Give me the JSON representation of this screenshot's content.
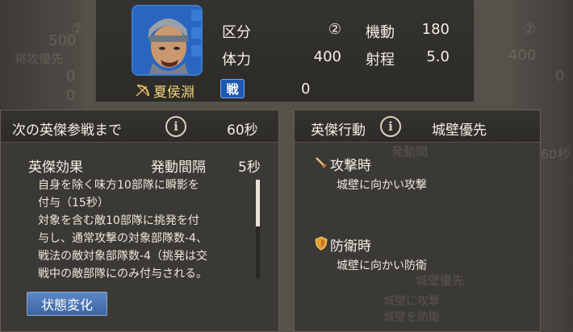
{
  "hero": {
    "name": "夏侯淵",
    "troop_type_badge": "戦",
    "war_value": "0"
  },
  "stats": {
    "category_label": "区分",
    "category_value": "②",
    "mobility_label": "機動",
    "mobility_value": "180",
    "hp_label": "体力",
    "hp_value": "400",
    "range_label": "射程",
    "range_value": "5.0"
  },
  "left_panel": {
    "next_join_label": "次の英傑参戦まで",
    "next_join_value": "60秒",
    "effect_label": "英傑効果",
    "interval_label": "発動間隔",
    "interval_value": "5秒",
    "description_lines": [
      "自身を除く味方10部隊に瞬影を",
      "付与（15秒）",
      "対象を含む敵10部隊に挑発を付",
      "与し、通常攻撃の対象部隊数-4、",
      "戦法の敵対象部隊数-4（挑発は交",
      "戦中の敵部隊にのみ付与される。"
    ],
    "status_button": "状態変化"
  },
  "right_panel": {
    "action_label": "英傑行動",
    "action_value": "城壁優先",
    "attack_label": "攻撃時",
    "attack_desc": "城壁に向かい攻撃",
    "defense_label": "防衛時",
    "defense_desc": "城壁に向かい防衛"
  },
  "background_ghost": {
    "left_num1": "②",
    "left_num2": "500",
    "left_label": "将攻優先",
    "left_num3": "0",
    "left_num4": "0",
    "right_num1": "②",
    "right_num2": "400",
    "right_num3": "0",
    "right_text1": "60秒",
    "right_text2": "発動間",
    "right_text3": "城壁優先",
    "right_text4": "城壁に攻撃",
    "right_text5": "城壁を防衛"
  },
  "colors": {
    "accent_blue": "#3a7bd6",
    "name_gold": "#f3d67a",
    "panel_bg": "#3b3935"
  },
  "icons": {
    "info": "info-circle-icon",
    "attack": "sword-icon",
    "defense": "shield-icon",
    "bow": "bow-icon"
  }
}
